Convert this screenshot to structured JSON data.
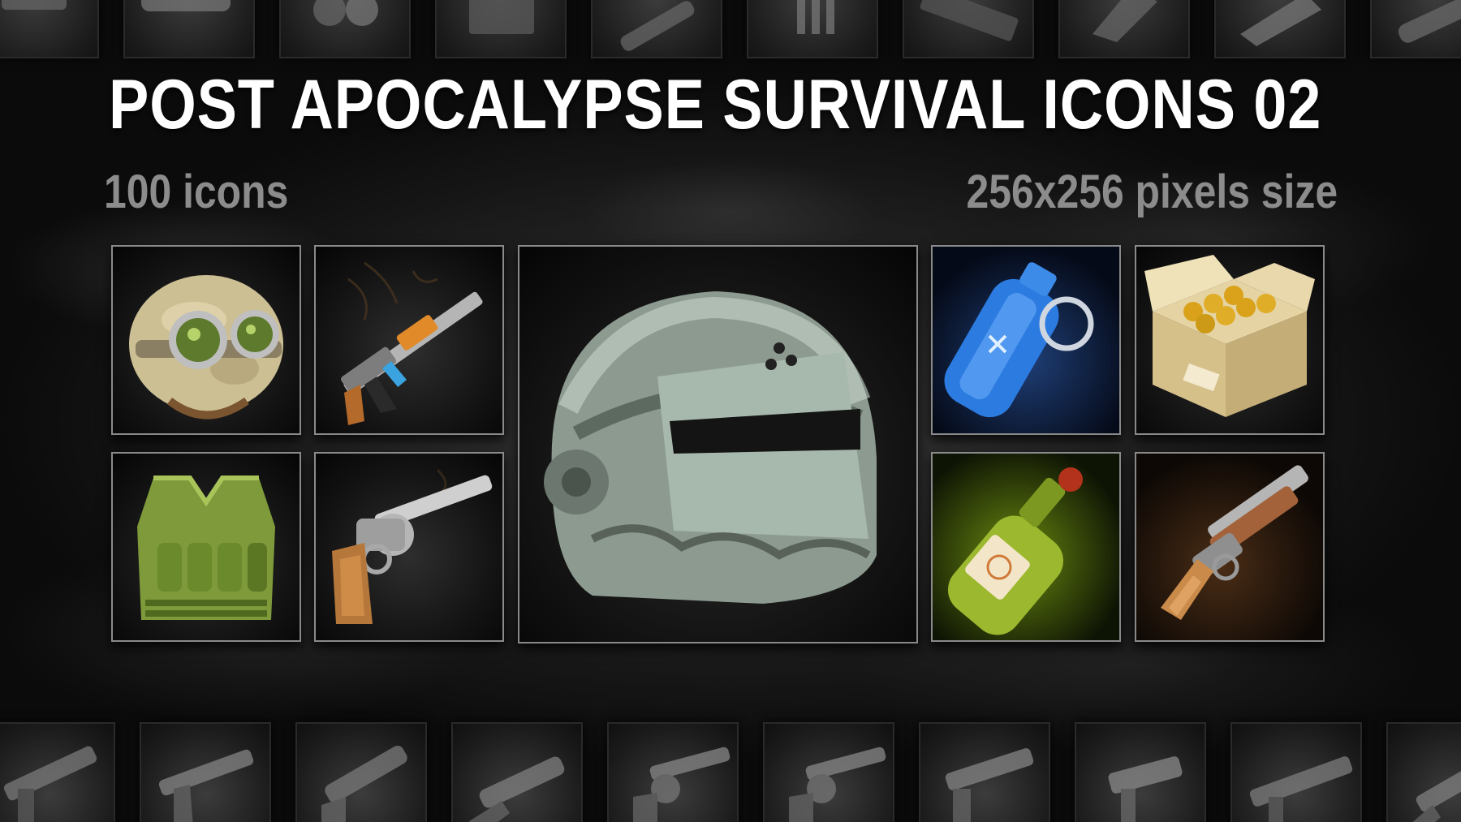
{
  "banner": {
    "title": "POST APOCALYPSE SURVIVAL ICONS 02",
    "count_text": "100 icons",
    "size_text": "256x256  pixels size"
  },
  "featured_icons": [
    {
      "name": "goggles-helmet-icon"
    },
    {
      "name": "assault-rifle-icon"
    },
    {
      "name": "riot-helmet-icon"
    },
    {
      "name": "smoke-grenade-icon"
    },
    {
      "name": "ammo-box-icon"
    },
    {
      "name": "tactical-vest-icon"
    },
    {
      "name": "revolver-icon"
    },
    {
      "name": "molotov-bottle-icon"
    },
    {
      "name": "sawed-off-shotgun-icon"
    }
  ],
  "colors": {
    "title": "#ffffff",
    "subtitle": "#8c8c8c",
    "tile_border": "#8a8a8a"
  }
}
